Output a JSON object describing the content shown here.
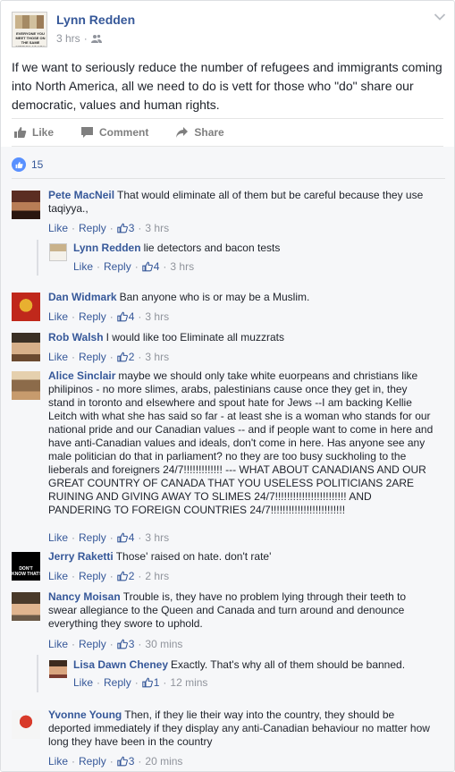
{
  "post": {
    "author": "Lynn Redden",
    "avatar_caption": "EVERYONE YOU MEET THOSE ON THE SAME MISSION AS YOU",
    "time": "3 hrs",
    "audience_icon": "friends-icon",
    "text": "If we want to seriously reduce the number of refugees and immigrants coming into North America, all we need to do is vett for those who \"do\" share our democratic, values and human rights."
  },
  "actions": [
    {
      "label": "Like",
      "icon": "thumbs-up-icon"
    },
    {
      "label": "Comment",
      "icon": "comment-icon"
    },
    {
      "label": "Share",
      "icon": "share-icon"
    }
  ],
  "reactions": {
    "count": "15",
    "icon": "like-reaction-icon"
  },
  "comment_actions": {
    "like": "Like",
    "reply": "Reply",
    "dot": "·"
  },
  "comments": [
    {
      "name": "Pete MacNeil",
      "text": "That would eliminate all of them but be careful because they use taqiyya.,",
      "likes": "3",
      "time": "3 hrs"
    },
    {
      "name": "Lynn Redden",
      "text": "lie detectors and bacon tests",
      "likes": "4",
      "time": "3 hrs"
    },
    {
      "name": "Dan Widmark",
      "text": "Ban anyone who is or may be a Muslim.",
      "likes": "4",
      "time": "3 hrs"
    },
    {
      "name": "Rob Walsh",
      "text": "I would like too Eliminate all muzzrats",
      "likes": "2",
      "time": "3 hrs"
    },
    {
      "name": "Alice Sinclair",
      "text": "maybe we should only take white euorpeans and christians like philipinos - no more slimes, arabs, palestinians cause once they get in, they stand in toronto and elsewhere and spout hate for Jews --I am backing Kellie Leitch with what she has said so far - at least she is a woman who stands for our national pride and our Canadian values -- and if people want to come in here and have anti-Canadian values and ideals, don't come in here. Has anyone see any male politician do that in parliament? no they are too busy suckholing to the lieberals and foreigners 24/7!!!!!!!!!!!!! --- WHAT ABOUT CANADIANS AND OUR GREAT COUNTRY OF CANADA THAT YOU USELESS POLITICIANS 2ARE RUINING AND GIVING AWAY TO SLIMES 24/7!!!!!!!!!!!!!!!!!!!!!!!! AND PANDERING TO FOREIGN COUNTRIES 24/7!!!!!!!!!!!!!!!!!!!!!!!!!",
      "likes": "4",
      "time": "3 hrs"
    },
    {
      "name": "Jerry Raketti",
      "text": "Those' raised on hate. don't rate'",
      "likes": "2",
      "time": "2 hrs",
      "avatar_caption": "DON'T KNOW THAT!"
    },
    {
      "name": "Nancy Moisan",
      "text": "Trouble is, they have no problem lying through their teeth to swear allegiance to the Queen and Canada and turn around and denounce everything they swore to uphold.",
      "likes": "3",
      "time": "30 mins"
    },
    {
      "name": "Lisa Dawn Cheney",
      "text": "Exactly. That's why all of them should be banned.",
      "likes": "1",
      "time": "12 mins"
    },
    {
      "name": "Yvonne Young",
      "text": "Then, if they lie their way into the country, they should be deported immediately if they display any anti-Canadian behaviour no matter how long they have been in the country",
      "likes": "3",
      "time": "20 mins"
    }
  ]
}
